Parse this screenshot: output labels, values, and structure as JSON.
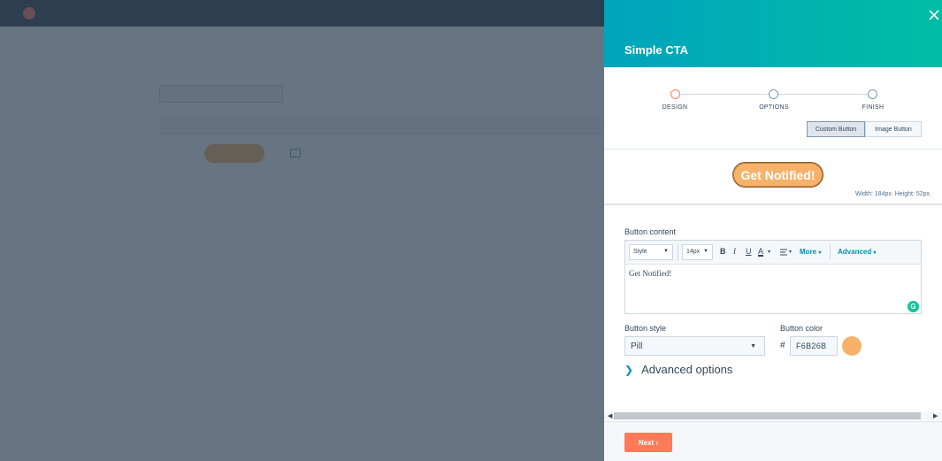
{
  "panel": {
    "title": "Simple CTA",
    "steps": [
      {
        "label": "DESIGN",
        "active": true
      },
      {
        "label": "OPTIONS",
        "active": false
      },
      {
        "label": "FINISH",
        "active": false
      }
    ],
    "button_type": {
      "options": [
        "Custom Button",
        "Image Button"
      ],
      "selected": "Custom Button"
    },
    "preview": {
      "label": "Get Notified!",
      "dimensions": "Width: 184px. Height: 52px."
    },
    "button_content": {
      "label": "Button content",
      "toolbar": {
        "style_select": "Style",
        "size_select": "14px",
        "bold": "B",
        "italic": "I",
        "underline": "U",
        "font_color": "A",
        "more": "More",
        "advanced": "Advanced"
      },
      "text": "Get Notified!"
    },
    "button_style": {
      "label": "Button style",
      "value": "Pill"
    },
    "button_color": {
      "label": "Button color",
      "prefix": "#",
      "value": "F6B26B",
      "swatch": "#f6b26b"
    },
    "advanced_options": "Advanced options",
    "next_label": "Next"
  },
  "colors": {
    "accent": "#ff7a59",
    "header_gradient_start": "#00a4bd",
    "header_gradient_end": "#00bda5",
    "cta_fill": "#f6b26b"
  },
  "icons": [
    "close-icon",
    "bold-icon",
    "italic-icon",
    "underline-icon",
    "font-color-icon",
    "align-icon",
    "chevron-right-icon",
    "grammarly-icon",
    "scroll-left-icon",
    "scroll-right-icon"
  ]
}
